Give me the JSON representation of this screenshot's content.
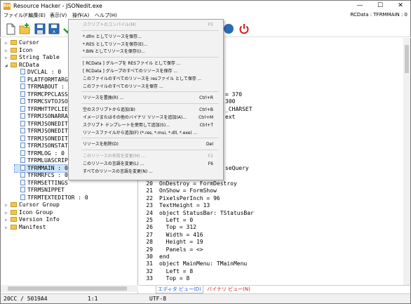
{
  "window": {
    "title": "Resource Hacker - JSONedit.exe",
    "app_icon_text": "RH",
    "minimize": "—",
    "maximize": "☐",
    "close": "✕"
  },
  "menubar": {
    "items": [
      "ファイル(F)",
      "編集(E)",
      "表示(V)",
      "操作(A)",
      "ヘルプ(H)"
    ],
    "resource_label": "RCData : TFRMMAIN : 0"
  },
  "tree": {
    "lines": [
      {
        "exp": "▷",
        "icon": "folder",
        "text": "Cursor"
      },
      {
        "exp": "▷",
        "icon": "folder",
        "text": "Icon"
      },
      {
        "exp": "▷",
        "icon": "folder",
        "text": "String Table"
      },
      {
        "exp": "◢",
        "icon": "folder",
        "text": "RCData"
      },
      {
        "exp": "",
        "icon": "leaf",
        "text": "DVCLAL : 0"
      },
      {
        "exp": "",
        "icon": "leaf",
        "text": "PLATFORMTARG"
      },
      {
        "exp": "",
        "icon": "leaf",
        "text": "TFRMABOUT : 0"
      },
      {
        "exp": "",
        "icon": "leaf",
        "text": "TFRMCPPCLASS"
      },
      {
        "exp": "",
        "icon": "leaf",
        "text": "TFRMCSVTOJSO"
      },
      {
        "exp": "",
        "icon": "leaf",
        "text": "TFRMHTTPCLIE"
      },
      {
        "exp": "",
        "icon": "leaf",
        "text": "TFRMJSONARRA"
      },
      {
        "exp": "",
        "icon": "leaf",
        "text": "TFRMJSONEDIT"
      },
      {
        "exp": "",
        "icon": "leaf",
        "text": "TFRMJSONEDIT"
      },
      {
        "exp": "",
        "icon": "leaf",
        "text": "TFRMJSONEDIT"
      },
      {
        "exp": "",
        "icon": "leaf",
        "text": "TFRMJSONSTAT"
      },
      {
        "exp": "",
        "icon": "leaf",
        "text": "TFRMLOG : 0"
      },
      {
        "exp": "",
        "icon": "leaf",
        "text": "TFRMLUASCRIP"
      },
      {
        "exp": "",
        "icon": "leaf",
        "text": "TFRMMAIN : 0"
      },
      {
        "exp": "",
        "icon": "leaf",
        "text": "TFRMRFCS : 0"
      },
      {
        "exp": "",
        "icon": "leaf",
        "text": "TFRMSETTINGS"
      },
      {
        "exp": "",
        "icon": "leaf",
        "text": "TFRMSNIPPET"
      },
      {
        "exp": "",
        "icon": "leaf",
        "text": "TFRMTEXTEDITOR : 0"
      },
      {
        "exp": "▷",
        "icon": "folder",
        "text": "Cursor Group"
      },
      {
        "exp": "▷",
        "icon": "folder",
        "text": "Icon Group"
      },
      {
        "exp": "▷",
        "icon": "folder",
        "text": "Version Info"
      },
      {
        "exp": "▷",
        "icon": "folder",
        "text": "Manifest"
      }
    ]
  },
  "editor": {
    "visible_right_fragments": [
      {
        "text": "= 370"
      },
      {
        "text": "300"
      },
      {
        "text": "_CHARSET"
      },
      {
        "text": "ext"
      },
      {
        "text": "seQuery"
      }
    ],
    "lines": [
      {
        "n": "20",
        "code": "OnDestroy = FormDestroy"
      },
      {
        "n": "21",
        "code": "OnShow = FormShow"
      },
      {
        "n": "22",
        "code": "PixelsPerInch = 96"
      },
      {
        "n": "23",
        "code": "TextHeight = 13"
      },
      {
        "n": "24",
        "code": "object StatusBar: TStatusBar"
      },
      {
        "n": "25",
        "code": "  Left = 0"
      },
      {
        "n": "26",
        "code": "  Top = 312"
      },
      {
        "n": "27",
        "code": "  Width = 416"
      },
      {
        "n": "28",
        "code": "  Height = 19"
      },
      {
        "n": "29",
        "code": "  Panels = <>"
      },
      {
        "n": "30",
        "code": "end"
      },
      {
        "n": "31",
        "code": "object MainMenu: TMainMenu"
      },
      {
        "n": "32",
        "code": "  Left = 8"
      },
      {
        "n": "33",
        "code": "  Top = 8"
      }
    ]
  },
  "tabs": {
    "editor_view": "エディタ ビュー(D)",
    "binary_view": "バイナリ ビュー(N)",
    "editor_color": "#1e5fcc",
    "binary_color": "#c02020"
  },
  "statusbar": {
    "offset": "20CC / 5019A4",
    "cursor": "1:1",
    "encoding": "UTF-8"
  },
  "context_menu": {
    "items": [
      {
        "label": "スクリプトのコンパイル(M)",
        "shortcut": "F5",
        "disabled": true
      },
      {
        "sep": true
      },
      {
        "label": "*.dfm としてリソースを保存...",
        "shortcut": ""
      },
      {
        "label": "*.RES としてリソースを保存(E)...",
        "shortcut": ""
      },
      {
        "label": "*.BIN としてリソースを保存(I)...",
        "shortcut": ""
      },
      {
        "sep": true
      },
      {
        "label": "[ RCData ] グループを RESファイル として保存 ...",
        "shortcut": ""
      },
      {
        "label": "[ RCData ] グループのすべてのリソースを保存 ...",
        "shortcut": ""
      },
      {
        "label": "このファイルのすべてのリソースを resファイル として保存 ...",
        "shortcut": ""
      },
      {
        "label": "このファイルのすべてのリソースを保存 ...",
        "shortcut": ""
      },
      {
        "sep": true
      },
      {
        "label": "リソースを置換(R) ...",
        "shortcut": "Ctrl+R"
      },
      {
        "sep": true
      },
      {
        "label": "空のスクリプトから追加(B)",
        "shortcut": "Ctrl+B"
      },
      {
        "label": "イメージまたはその他のバイナリ リソースを追加(A)...",
        "shortcut": "Ctrl+M"
      },
      {
        "label": "スクリプト テンプレートを使用して追加(S)...",
        "shortcut": "Ctrl+T"
      },
      {
        "label": "リソースファイルから追加(F) (*.res, *.mui, *.dll, *.exe) ...",
        "shortcut": ""
      },
      {
        "sep": true
      },
      {
        "label": "リソースを削除(D)",
        "shortcut": "Del"
      },
      {
        "sep": true
      },
      {
        "label": "このリソースの名前を変更(M) ...",
        "shortcut": "F2",
        "disabled": true
      },
      {
        "label": "このリソースの言語を変更(L) ...",
        "shortcut": "F6"
      },
      {
        "label": "すべてのリソースの言語を変更(N) ...",
        "shortcut": ""
      }
    ]
  }
}
